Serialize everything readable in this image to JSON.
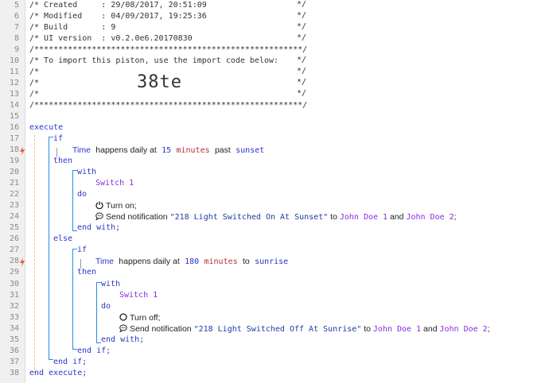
{
  "header": {
    "created_label": "/* Created     : 29/08/2017, 20:51:09",
    "modified_label": "/* Modified    : 04/09/2017, 19:25:36",
    "build_label": "/* Build       : 9",
    "ui_version_label": "/* UI version  : v0.2.0e6.20170830",
    "stars_line": "/********************************************************/",
    "import_line": "/* To import this piston, use the import code below:",
    "blank_comment": "/*",
    "comment_end": "*/",
    "import_code": "38te"
  },
  "line_numbers": [
    "5",
    "6",
    "7",
    "8",
    "9",
    "10",
    "11",
    "12",
    "13",
    "14",
    "15",
    "16",
    "17",
    "18",
    "19",
    "20",
    "21",
    "22",
    "23",
    "24",
    "25",
    "26",
    "27",
    "28",
    "29",
    "30",
    "31",
    "32",
    "33",
    "34",
    "35",
    "36",
    "37",
    "38"
  ],
  "code": {
    "execute": "execute",
    "if": "if",
    "then": "then",
    "else": "else",
    "with": "with",
    "do": "do",
    "end_with": "end with;",
    "end_if": "end if;",
    "end_execute": "end execute;",
    "cond1": {
      "subject": "Time",
      "op": "happens daily at",
      "value": "15",
      "unit": "minutes",
      "rel": "past",
      "ref": "sunset"
    },
    "cond2": {
      "subject": "Time",
      "op": "happens daily at",
      "value": "180",
      "unit": "minutes",
      "rel": "to",
      "ref": "sunrise"
    },
    "device": "Switch 1",
    "action_on": "Turn on;",
    "action_off": "Turn off;",
    "notify_on": {
      "prefix": "Send notification",
      "message": "\"218 Light Switched On At Sunset\"",
      "to": "to",
      "user1": "John Doe 1",
      "and": "and",
      "user2": "John Doe 2",
      "end": ";"
    },
    "notify_off": {
      "prefix": "Send notification",
      "message": "\"218 Light Switched Off At Sunrise\"",
      "to": "to",
      "user1": "John Doe 1",
      "and": "and",
      "user2": "John Doe 2",
      "end": ";"
    }
  },
  "colors": {
    "keyword": "#2a35c9",
    "device": "#8a2be2",
    "number": "#2a35c9",
    "unit": "#b5313b",
    "bolt": "#e8612c"
  },
  "icons": [
    "power-icon",
    "power-off-icon",
    "chat-bubble-icon",
    "lightning-bolt-icon"
  ]
}
